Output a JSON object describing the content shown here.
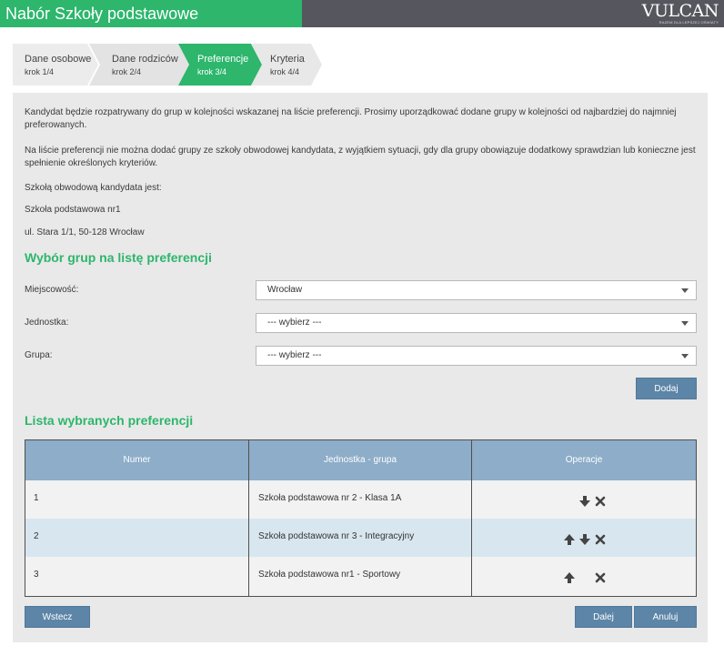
{
  "header": {
    "title": "Nabór Szkoły podstawowe",
    "logo": "VULCAN",
    "logo_tagline": "RAZEM DLA LEPSZEJ OŚWIATY"
  },
  "steps": [
    {
      "title": "Dane osobowe",
      "sub": "krok 1/4",
      "active": false
    },
    {
      "title": "Dane rodziców",
      "sub": "krok 2/4",
      "active": false
    },
    {
      "title": "Preferencje",
      "sub": "krok 3/4",
      "active": true
    },
    {
      "title": "Kryteria",
      "sub": "krok 4/4",
      "active": false
    }
  ],
  "info": {
    "para1": "Kandydat będzie rozpatrywany do grup w kolejności wskazanej na liście preferencji. Prosimy uporządkować dodane grupy w kolejności od najbardziej do najmniej preferowanych.",
    "para2": "Na liście preferencji nie można dodać grupy ze szkoły obwodowej kandydata, z wyjątkiem sytuacji, gdy dla grupy obowiązuje dodatkowy sprawdzian lub konieczne jest spełnienie określonych kryteriów.",
    "district_label": "Szkołą obwodową kandydata jest:",
    "district_school": "Szkoła podstawowa nr1",
    "district_address": "ul. Stara 1/1, 50-128 Wrocław"
  },
  "selection": {
    "heading": "Wybór grup na listę preferencji",
    "city_label": "Miejscowość:",
    "city_value": "Wrocław",
    "unit_label": "Jednostka:",
    "unit_value": "--- wybierz ---",
    "group_label": "Grupa:",
    "group_value": "--- wybierz ---",
    "add_label": "Dodaj"
  },
  "preferences": {
    "heading": "Lista wybranych preferencji",
    "columns": [
      "Numer",
      "Jednostka - grupa",
      "Operacje"
    ],
    "rows": [
      {
        "number": "1",
        "name": "Szkoła podstawowa nr 2 - Klasa 1A",
        "ops": [
          "down",
          "remove"
        ]
      },
      {
        "number": "2",
        "name": "Szkoła podstawowa nr 3 - Integracyjny",
        "ops": [
          "up",
          "down",
          "remove"
        ]
      },
      {
        "number": "3",
        "name": "Szkoła podstawowa nr1 - Sportowy",
        "ops": [
          "up",
          "remove"
        ]
      }
    ]
  },
  "actions": {
    "back_label": "Wstecz",
    "next_label": "Dalej",
    "cancel_label": "Anuluj"
  },
  "colors": {
    "accent": "#2db66c",
    "topbar": "#56565e",
    "button": "#5d85a7",
    "table_header": "#8dadc8"
  }
}
